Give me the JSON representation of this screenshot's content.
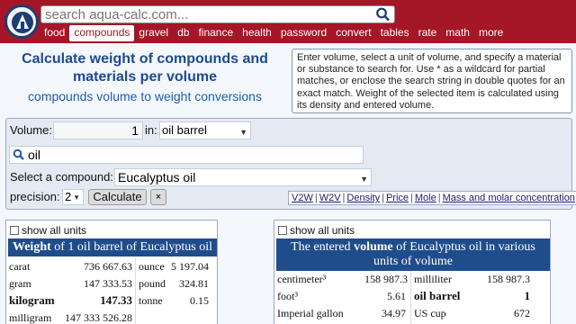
{
  "search": {
    "placeholder": "search aqua-calc.com..."
  },
  "nav": [
    {
      "label": "food"
    },
    {
      "label": "compounds",
      "active": true
    },
    {
      "label": "gravel"
    },
    {
      "label": "db"
    },
    {
      "label": "finance"
    },
    {
      "label": "health"
    },
    {
      "label": "password"
    },
    {
      "label": "convert"
    },
    {
      "label": "tables"
    },
    {
      "label": "rate"
    },
    {
      "label": "math"
    },
    {
      "label": "more"
    }
  ],
  "title": "Calculate weight of compounds and materials per volume",
  "subtitle": "compounds volume to weight conversions",
  "help_text": "Enter volume, select a unit of volume, and specify a material or substance to search for. Use * as a wildcard for partial matches, or enclose the search string in double quotes for an exact match. Weight of the selected item is calculated using its density and entered volume.",
  "form": {
    "volume_label": "Volume:",
    "volume_value": "1",
    "in_label": "in:",
    "unit_selected": "oil barrel",
    "substance_search": "oil",
    "compound_label": "Select a compound:",
    "compound_selected": "Eucalyptus oil",
    "precision_label": "precision:",
    "precision_value": "2",
    "calculate_label": "Calculate",
    "clear_label": "×"
  },
  "tool_links": [
    "V2W",
    "W2V",
    "Density",
    "Price",
    "Mole",
    "Mass and molar concentration"
  ],
  "left_panel": {
    "show_all": "show all units",
    "header_bold": "Weight",
    "header_rest": " of 1 oil barrel of Eucalyptus oil",
    "rows": [
      {
        "unit": "carat",
        "value": "736 667.63",
        "unit2": "ounce",
        "value2": "5 197.04"
      },
      {
        "unit": "gram",
        "value": "147 333.53",
        "unit2": "pound",
        "value2": "324.81"
      },
      {
        "unit": "kilogram",
        "value": "147.33",
        "unit2": "tonne",
        "value2": "0.15",
        "bold": true
      },
      {
        "unit": "milligram",
        "value": "147 333 526.28",
        "unit2": "",
        "value2": ""
      }
    ]
  },
  "right_panel": {
    "show_all": "show all units",
    "header_pre": "The entered ",
    "header_bold": "volume",
    "header_post": " of Eucalyptus oil in various units of volume",
    "rows": [
      {
        "unit": "centimeter³",
        "value": "158 987.3",
        "unit2": "milliliter",
        "value2": "158 987.3"
      },
      {
        "unit": "foot³",
        "value": "5.61",
        "unit2": "oil barrel",
        "value2": "1",
        "bold2": true
      },
      {
        "unit": "Imperial gallon",
        "value": "34.97",
        "unit2": "US cup",
        "value2": "672"
      }
    ]
  },
  "colors": {
    "header_red": "#a51626",
    "table_blue": "#1f4d8c",
    "title_blue": "#1c4a93"
  }
}
